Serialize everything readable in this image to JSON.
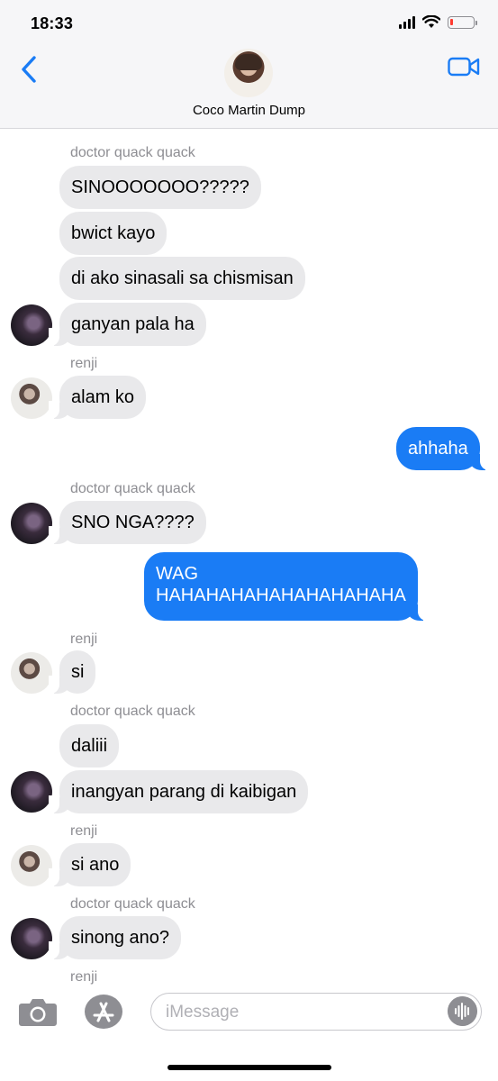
{
  "status_bar": {
    "time": "18:33",
    "battery_level": 0.12
  },
  "header": {
    "group_name": "Coco Martin Dump",
    "back_icon": "chevron-left-icon",
    "call_icon": "video-camera-icon"
  },
  "messages": [
    {
      "sender": "doctor quack quack"
    },
    {
      "text": "SINOOOOOOO?????"
    },
    {
      "text": "bwict kayo"
    },
    {
      "text": "di ako sinasali sa chismisan"
    },
    {
      "text": "ganyan pala ha"
    },
    {
      "sender": "renji"
    },
    {
      "text": "alam ko"
    },
    {
      "text": "ahhaha"
    },
    {
      "sender": "doctor quack quack"
    },
    {
      "text": "SNO NGA????"
    },
    {
      "text": "WAG\nHAHAHAHAHAHAHAHAHAHA"
    },
    {
      "sender": "renji"
    },
    {
      "text": "si"
    },
    {
      "sender": "doctor quack quack"
    },
    {
      "text": "daliii"
    },
    {
      "text": "inangyan parang di kaibigan"
    },
    {
      "sender": "renji"
    },
    {
      "text": "si ano"
    },
    {
      "sender": "doctor quack quack"
    },
    {
      "text": "sinong ano?"
    },
    {
      "sender": "renji"
    }
  ],
  "input": {
    "placeholder": "iMessage"
  },
  "colors": {
    "outgoing": "#1a7cf5",
    "incoming": "#e9e9eb",
    "accent": "#1a7cf5"
  }
}
